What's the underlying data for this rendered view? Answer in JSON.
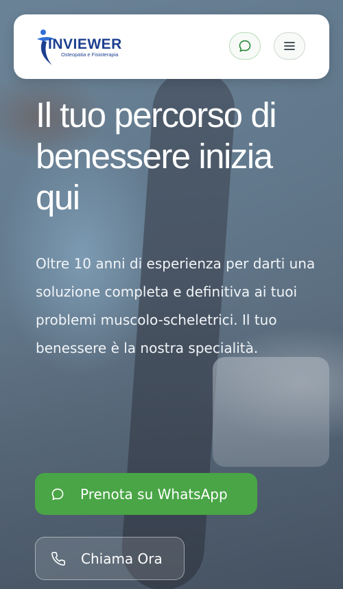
{
  "header": {
    "logo": {
      "name": "INVIEWER",
      "tagline": "Osteopatia e Fisioterapia"
    },
    "chat_icon": "chat-bubble-icon",
    "menu_icon": "hamburger-menu-icon"
  },
  "hero": {
    "title": "Il tuo percorso di benessere inizia qui",
    "subtitle": "Oltre 10 anni di esperienza per darti una soluzione completa e definitiva ai tuoi problemi muscolo-scheletrici. Il tuo benessere è la nostra specialità."
  },
  "cta": {
    "whatsapp_label": "Prenota su WhatsApp",
    "whatsapp_icon": "chat-bubble-icon",
    "call_label": "Chiama Ora",
    "call_icon": "phone-icon"
  },
  "colors": {
    "brand_blue": "#1c3f8f",
    "whatsapp_green": "#49a546",
    "header_bg": "#ffffff"
  }
}
